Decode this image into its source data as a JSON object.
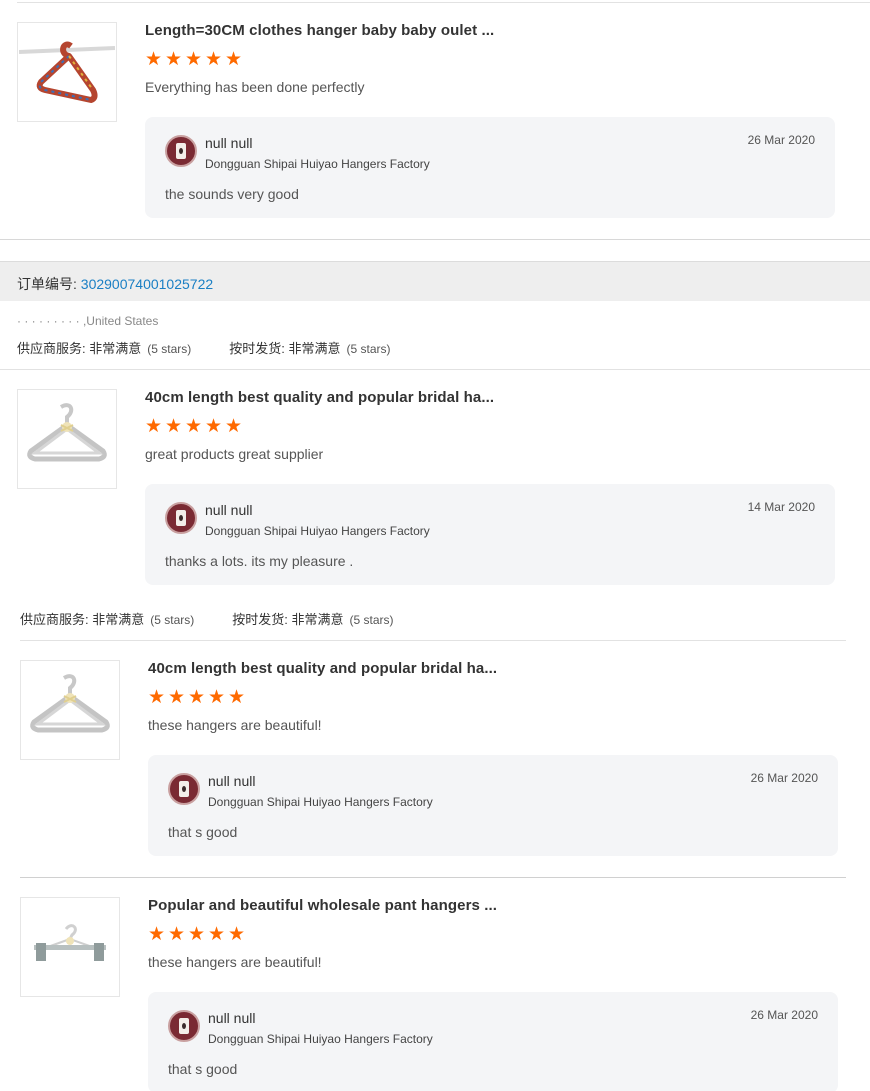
{
  "colors": {
    "star": "#ff6a00",
    "link": "#1a7fc4",
    "reply_bg": "#f4f5f7",
    "order_bar_bg": "#eeeeee"
  },
  "star_icon": "★",
  "reviews": [
    {
      "product_title": "Length=30CM clothes hanger baby baby oulet ...",
      "rating": 5,
      "review_text": "Everything has been done perfectly",
      "thumb_icon": "rainbow-hanger-image",
      "reply": {
        "name": "null null",
        "company": "Dongguan Shipai Huiyao Hangers Factory",
        "date": "26 Mar 2020",
        "message": "the sounds very good"
      }
    },
    {
      "product_title": "40cm length best quality and popular bridal ha...",
      "rating": 5,
      "review_text": "great products great supplier",
      "thumb_icon": "white-hangers-image",
      "reply": {
        "name": "null null",
        "company": "Dongguan Shipai Huiyao Hangers Factory",
        "date": "14 Mar 2020",
        "message": "thanks a lots. its my pleasure ."
      }
    },
    {
      "product_title": "40cm length best quality and popular bridal ha...",
      "rating": 5,
      "review_text": "these hangers are beautiful!",
      "thumb_icon": "white-hangers-image",
      "reply": {
        "name": "null null",
        "company": "Dongguan Shipai Huiyao Hangers Factory",
        "date": "26 Mar 2020",
        "message": "that s good"
      }
    },
    {
      "product_title": "Popular and beautiful wholesale pant hangers ...",
      "rating": 5,
      "review_text": "these hangers are beautiful!",
      "thumb_icon": "pant-hanger-image",
      "reply": {
        "name": "null null",
        "company": "Dongguan Shipai Huiyao Hangers Factory",
        "date": "26 Mar 2020",
        "message": "that s good"
      }
    }
  ],
  "order": {
    "label": "订单编号: ",
    "number": "30290074001025722",
    "location": "· · · · · · · · · ,United States",
    "supplier_service_label": "供应商服务: 非常满意",
    "supplier_service_stars": "(5 stars)",
    "on_time_label": "按时发货: 非常满意",
    "on_time_stars": "(5 stars)"
  },
  "order_ratings_2": {
    "supplier_service_label": "供应商服务: 非常满意",
    "supplier_service_stars": "(5 stars)",
    "on_time_label": "按时发货: 非常满意",
    "on_time_stars": "(5 stars)"
  }
}
